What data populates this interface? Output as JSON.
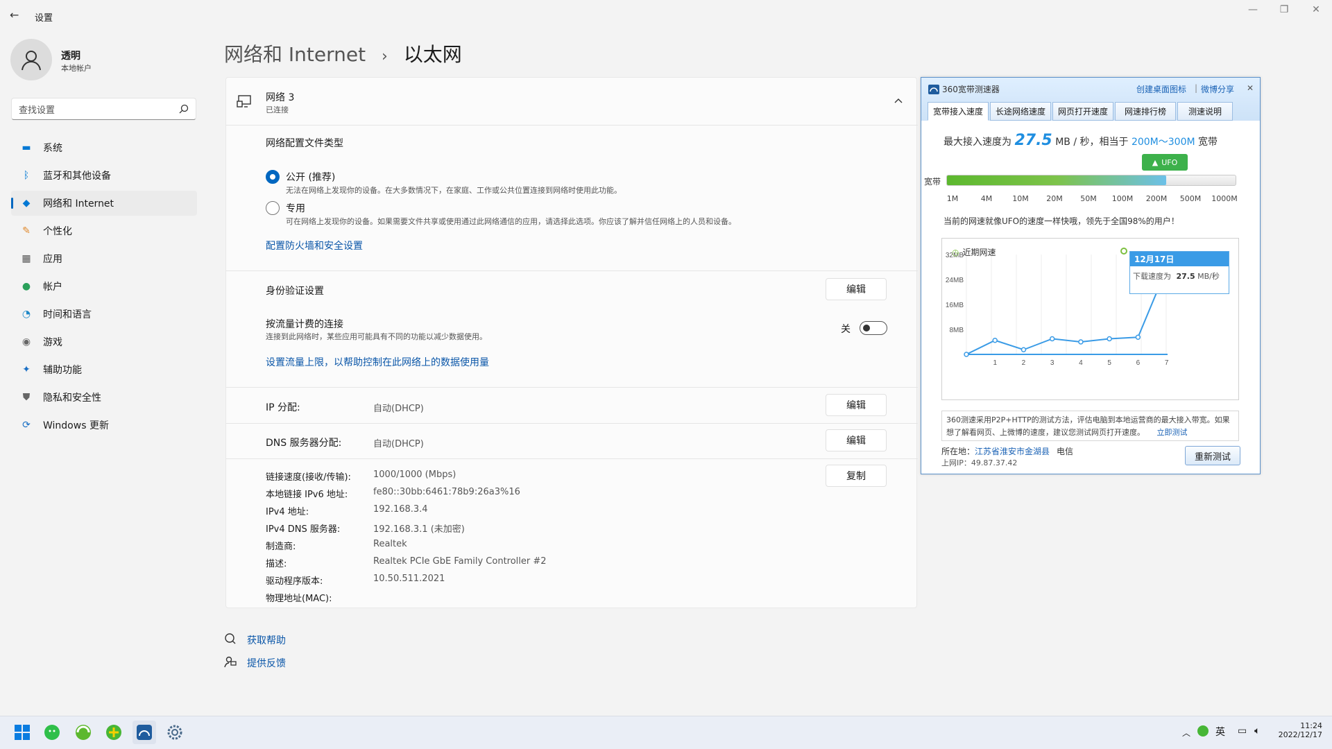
{
  "window": {
    "back": "←",
    "title": "设置",
    "minimize": "—",
    "maximize": "❐",
    "close": "✕"
  },
  "user": {
    "name": "透明",
    "type": "本地帐户"
  },
  "search": {
    "placeholder": "查找设置"
  },
  "nav": [
    {
      "label": "系统",
      "icon": "system-icon",
      "color": "#0078d4",
      "selected": false
    },
    {
      "label": "蓝牙和其他设备",
      "icon": "bluetooth-icon",
      "color": "#0078d4",
      "selected": false
    },
    {
      "label": "网络和 Internet",
      "icon": "network-icon",
      "color": "#0078d4",
      "selected": true
    },
    {
      "label": "个性化",
      "icon": "brush-icon",
      "color": "#e08a2e",
      "selected": false
    },
    {
      "label": "应用",
      "icon": "apps-icon",
      "color": "#555555",
      "selected": false
    },
    {
      "label": "帐户",
      "icon": "account-icon",
      "color": "#2aa05a",
      "selected": false
    },
    {
      "label": "时间和语言",
      "icon": "time-language-icon",
      "color": "#1e88c7",
      "selected": false
    },
    {
      "label": "游戏",
      "icon": "gaming-icon",
      "color": "#666666",
      "selected": false
    },
    {
      "label": "辅助功能",
      "icon": "accessibility-icon",
      "color": "#1a6fc4",
      "selected": false
    },
    {
      "label": "隐私和安全性",
      "icon": "shield-icon",
      "color": "#666666",
      "selected": false
    },
    {
      "label": "Windows 更新",
      "icon": "update-icon",
      "color": "#1a6fc4",
      "selected": false
    }
  ],
  "breadcrumb": {
    "parent": "网络和 Internet",
    "separator": "›",
    "current": "以太网"
  },
  "network": {
    "name": "网络 3",
    "status": "已连接",
    "profile_title": "网络配置文件类型",
    "public_label": "公开 (推荐)",
    "public_desc": "无法在网络上发现你的设备。在大多数情况下，在家庭、工作或公共位置连接到网络时使用此功能。",
    "private_label": "专用",
    "private_desc": "可在网络上发现你的设备。如果需要文件共享或使用通过此网络通信的应用，请选择此选项。你应该了解并信任网络上的人员和设备。",
    "firewall_link": "配置防火墙和安全设置",
    "auth_label": "身份验证设置",
    "edit": "编辑",
    "metered_label": "按流量计费的连接",
    "metered_desc": "连接到此网络时，某些应用可能具有不同的功能以减少数据使用。",
    "metered_state": "关",
    "data_limit_link": "设置流量上限，以帮助控制在此网络上的数据使用量",
    "ip_label": "IP 分配:",
    "ip_value": "自动(DHCP)",
    "dns_label": "DNS 服务器分配:",
    "dns_value": "自动(DHCP)",
    "copy": "复制",
    "props": [
      {
        "k": "链接速度(接收/传输):",
        "v": "1000/1000 (Mbps)"
      },
      {
        "k": "本地链接 IPv6 地址:",
        "v": "fe80::30bb:6461:78b9:26a3%16"
      },
      {
        "k": "IPv4 地址:",
        "v": "192.168.3.4"
      },
      {
        "k": "IPv4 DNS 服务器:",
        "v": "192.168.3.1 (未加密)"
      },
      {
        "k": "制造商:",
        "v": "Realtek"
      },
      {
        "k": "描述:",
        "v": "Realtek PCIe GbE Family Controller #2"
      },
      {
        "k": "驱动程序版本:",
        "v": "10.50.511.2021"
      },
      {
        "k": "物理地址(MAC):",
        "v": ""
      }
    ]
  },
  "help": {
    "get_help": "获取帮助",
    "feedback": "提供反馈"
  },
  "speedtest": {
    "title": "360宽带测速器",
    "create_icon": "创建桌面图标",
    "divider": "|",
    "share": "微博分享",
    "close": "✕",
    "tabs": [
      "宽带接入速度",
      "长途网络速度",
      "网页打开速度",
      "网速排行榜",
      "测速说明"
    ],
    "max_prefix": "最大接入速度为",
    "max_value": "27.5",
    "max_unit": "MB / 秒，相当于",
    "bandwidth": "200M～300M",
    "bandwidth_suffix": "宽带",
    "ufo_label": "UFO",
    "bar_label": "宽带",
    "bar_fraction": 0.76,
    "ticks": [
      "1M",
      "4M",
      "10M",
      "20M",
      "50M",
      "100M",
      "200M",
      "500M",
      "1000M"
    ],
    "message": "当前的网速就像UFO的速度一样快哦，领先于全国98%的用户！",
    "chart_title": "近期网速",
    "tooltip_date": "12月17日",
    "tooltip_prefix": "下载速度为",
    "tooltip_value": "27.5",
    "tooltip_unit": "MB/秒",
    "description": "360测速采用P2P+HTTP的测试方法，评估电脑到本地运营商的最大接入带宽。如果想了解看网页、上微博的速度，建议您测试网页打开速度。",
    "test_now": "立即测试",
    "location_label": "所在地：",
    "location": "江苏省淮安市金湖县",
    "isp": "电信",
    "ip_label": "上网IP：",
    "ip": "49.87.37.42",
    "retest": "重新测试"
  },
  "chart_data": {
    "type": "line",
    "title": "近期网速",
    "x": [
      0,
      1,
      2,
      3,
      4,
      5,
      6,
      7
    ],
    "xticks": [
      "1",
      "2",
      "3",
      "4",
      "5",
      "6",
      "7"
    ],
    "series": [
      {
        "values": [
          0,
          4.5,
          1.5,
          5.0,
          4.0,
          5.0,
          5.5,
          27.5
        ]
      }
    ],
    "yticks": [
      "8MB",
      "16MB",
      "24MB",
      "32MB"
    ],
    "ylim": [
      0,
      32
    ]
  },
  "taskbar": {
    "icons": [
      "start-icon",
      "wechat-icon",
      "browser-icon",
      "360-security-icon",
      "speedtest-icon",
      "settings-icon"
    ],
    "tray_ime": "英",
    "time": "11:24",
    "date": "2022/12/17"
  }
}
